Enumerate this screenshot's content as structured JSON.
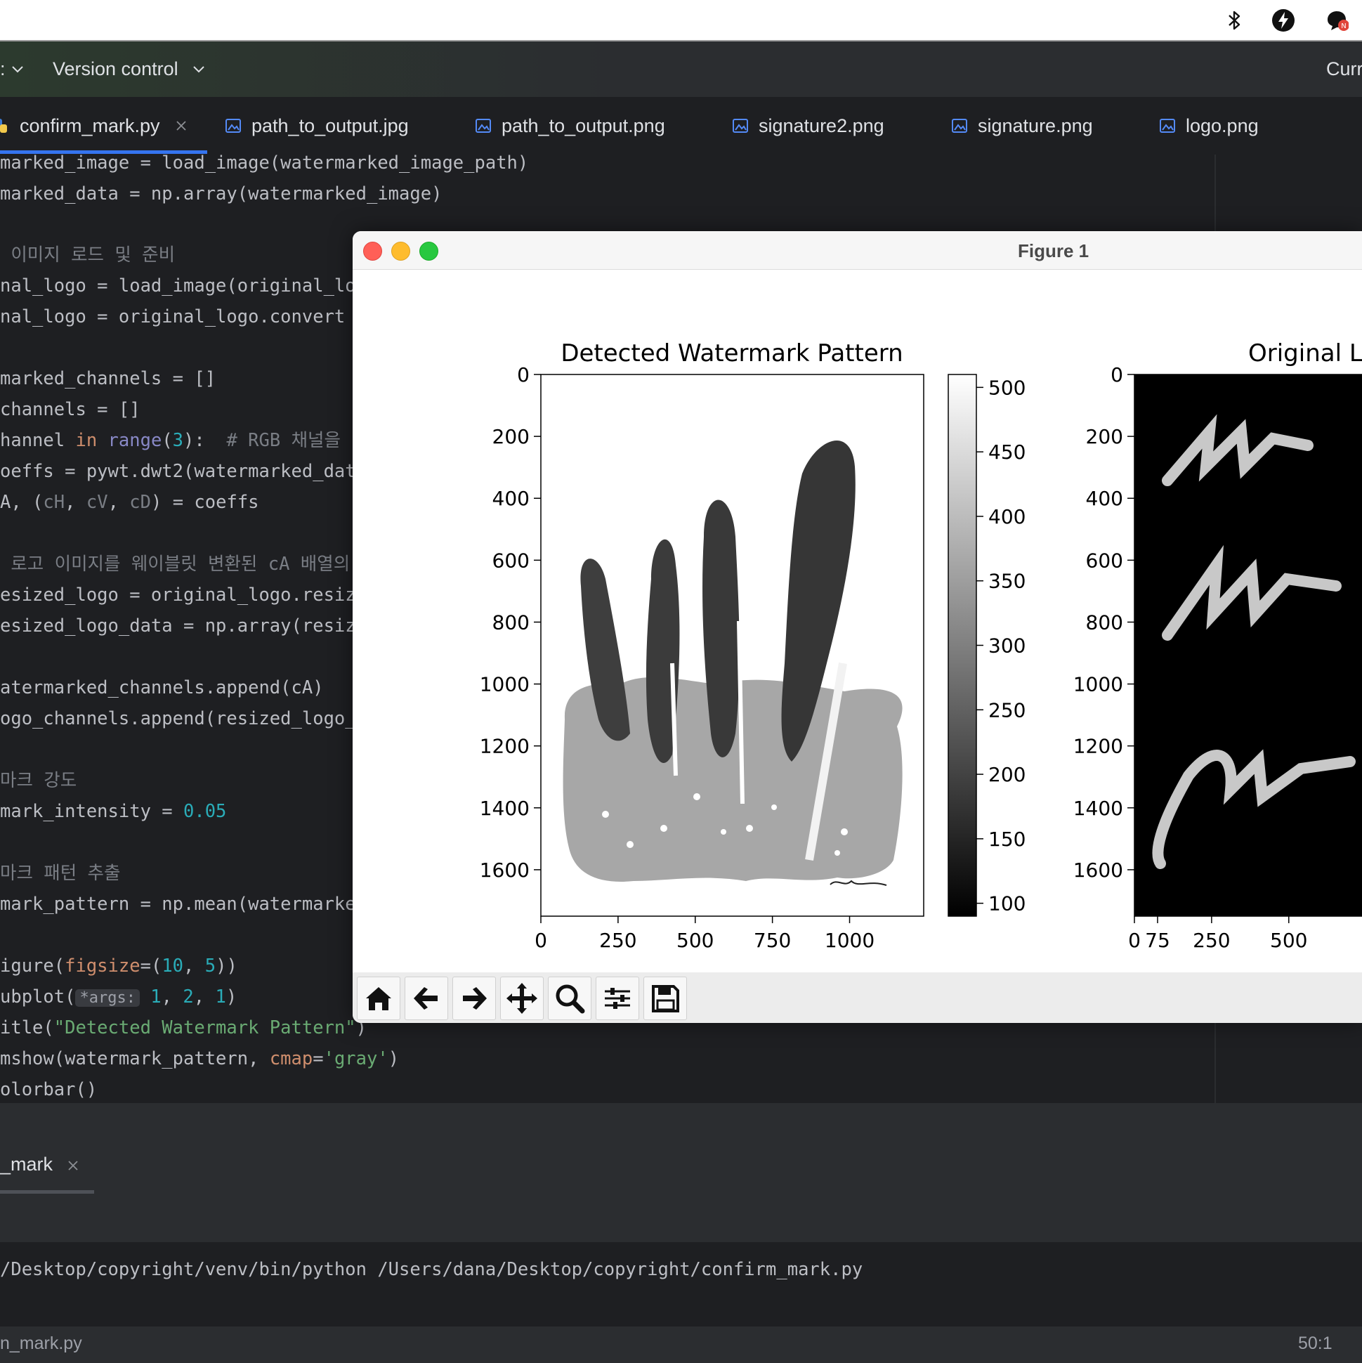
{
  "menubar": {
    "icons": [
      "bluetooth-icon",
      "flash-icon",
      "chat-bubble-icon"
    ],
    "badge": "N"
  },
  "header": {
    "project_fragment": ":",
    "vcs_label": "Version control",
    "run_config_fragment": "Curr"
  },
  "tabs": [
    {
      "label": "confirm_mark.py",
      "icon": "python-file-icon",
      "active": true
    },
    {
      "label": "path_to_output.jpg",
      "icon": "image-file-icon"
    },
    {
      "label": "path_to_output.png",
      "icon": "image-file-icon"
    },
    {
      "label": "signature2.png",
      "icon": "image-file-icon"
    },
    {
      "label": "signature.png",
      "icon": "image-file-icon"
    },
    {
      "label": "logo.png",
      "icon": "image-file-icon"
    }
  ],
  "code": {
    "l1": "marked_image = load_image(watermarked_image_path)",
    "l2": "marked_data = np.array(watermarked_image)",
    "l4": " 이미지 로드 및 준비",
    "l5": "nal_logo = load_image(original_lo",
    "l6": "nal_logo = original_logo.convert",
    "l8": "marked_channels = []",
    "l9": "channels = []",
    "l10a": "hannel ",
    "l10b": "in",
    "l10c": " ",
    "l10d": "range",
    "l10e": "(",
    "l10f": "3",
    "l10g": "):  ",
    "l10h": "# RGB 채널을",
    "l11": "oeffs = pywt.dwt2(watermarked_dat",
    "l12a": "A, (",
    "l12b": "cH",
    "l12c": ", ",
    "l12d": "cV",
    "l12e": ", ",
    "l12f": "cD",
    "l12g": ") = coeffs",
    "l14": " 로고 이미지를 웨이블릿 변환된 cA 배열의 ",
    "l15": "esized_logo = original_logo.resiz",
    "l16": "esized_logo_data = np.array(resiz",
    "l18": "atermarked_channels.append(cA)",
    "l19": "ogo_channels.append(resized_logo_",
    "l21": "마크 강도",
    "l22a": "mark_intensity = ",
    "l22b": "0.05",
    "l24": "마크 패턴 추출",
    "l25": "mark_pattern = np.mean(watermarke",
    "l27a": "igure(",
    "l27b": "figsize",
    "l27c": "=(",
    "l27d": "10",
    "l27e": ", ",
    "l27f": "5",
    "l27g": "))",
    "l28a": "ubplot(",
    "l28hint": "*args:",
    "l28b": " 1",
    "l28c": ", ",
    "l28d": "2",
    "l28e": ", ",
    "l28f": "1",
    "l28g": ")",
    "l29a": "itle(",
    "l29b": "\"Detected Watermark Pattern\"",
    "l29c": ")",
    "l30a": "mshow(watermark_pattern, ",
    "l30b": "cmap",
    "l30c": "=",
    "l30d": "'gray'",
    "l30e": ")",
    "l31": "olorbar()"
  },
  "run_panel": {
    "tab_label": "_mark",
    "command": "/Desktop/copyright/venv/bin/python /Users/dana/Desktop/copyright/confirm_mark.py"
  },
  "status": {
    "file": "n_mark.py",
    "position": "50:1"
  },
  "figure": {
    "window_title": "Figure 1",
    "toolbar": [
      "home-icon",
      "back-arrow-icon",
      "forward-arrow-icon",
      "pan-move-icon",
      "zoom-magnifier-icon",
      "subplots-config-icon",
      "save-disk-icon"
    ]
  },
  "chart_data": [
    {
      "type": "heatmap",
      "title": "Detected Watermark Pattern",
      "xlabel": "",
      "ylabel": "",
      "xlim": [
        0,
        1240
      ],
      "ylim": [
        1750,
        0
      ],
      "x_ticks": [
        "0",
        "250",
        "500",
        "750",
        "1000"
      ],
      "y_ticks": [
        "0",
        "200",
        "400",
        "600",
        "800",
        "1000",
        "1200",
        "1400",
        "1600"
      ],
      "colormap": "gray",
      "colorbar": {
        "range": [
          90,
          510
        ],
        "ticks": [
          "100",
          "150",
          "200",
          "250",
          "300",
          "350",
          "400",
          "450",
          "500"
        ]
      }
    },
    {
      "type": "heatmap",
      "title": "Original Lo",
      "xlabel": "",
      "ylabel": "",
      "x_ticks": [
        "0",
        "250",
        "500",
        "75"
      ],
      "y_ticks": [
        "0",
        "200",
        "400",
        "600",
        "800",
        "1000",
        "1200",
        "1400",
        "1600"
      ],
      "colormap": "gray"
    }
  ]
}
